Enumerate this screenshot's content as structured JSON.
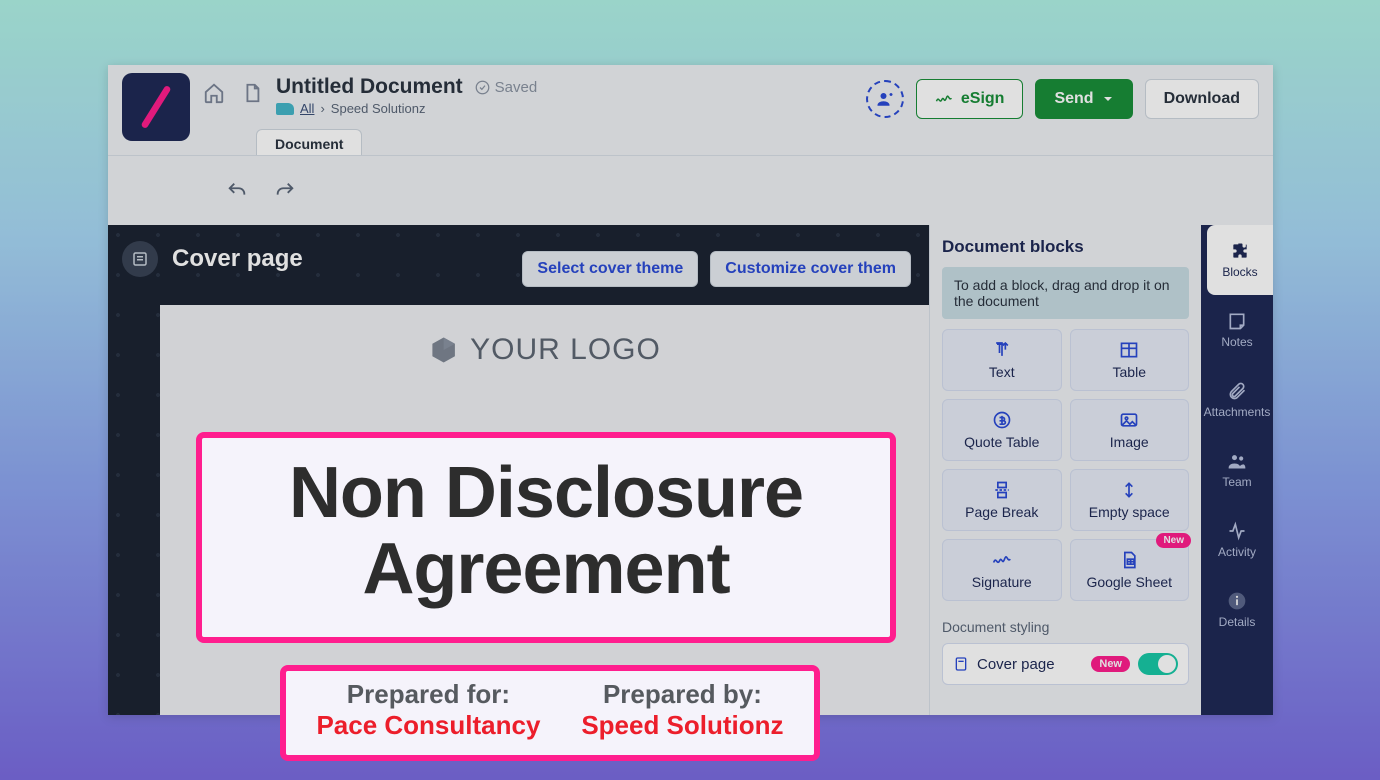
{
  "header": {
    "doc_title": "Untitled Document",
    "saved_label": "Saved",
    "breadcrumb_all": "All",
    "breadcrumb_client": "Speed Solutionz",
    "esign_label": "eSign",
    "send_label": "Send",
    "download_label": "Download",
    "tab_document": "Document"
  },
  "cover": {
    "section_title": "Cover page",
    "select_theme": "Select cover theme",
    "customize_theme": "Customize cover them",
    "logo_placeholder": "YOUR LOGO",
    "main_title": "Non Disclosure Agreement",
    "prepared_for_label": "Prepared for:",
    "prepared_for_value": "Pace Consultancy",
    "prepared_by_label": "Prepared by:",
    "prepared_by_value": "Speed Solutionz"
  },
  "panel": {
    "title": "Document blocks",
    "hint": "To add a block, drag and drop it on the document",
    "blocks": {
      "text": "Text",
      "table": "Table",
      "quote_table": "Quote Table",
      "image": "Image",
      "page_break": "Page Break",
      "empty_space": "Empty space",
      "signature": "Signature",
      "google_sheet": "Google Sheet"
    },
    "new_badge": "New",
    "styling_label": "Document styling",
    "cover_page_label": "Cover page"
  },
  "rail": {
    "blocks": "Blocks",
    "notes": "Notes",
    "attachments": "Attachments",
    "team": "Team",
    "activity": "Activity",
    "details": "Details"
  }
}
